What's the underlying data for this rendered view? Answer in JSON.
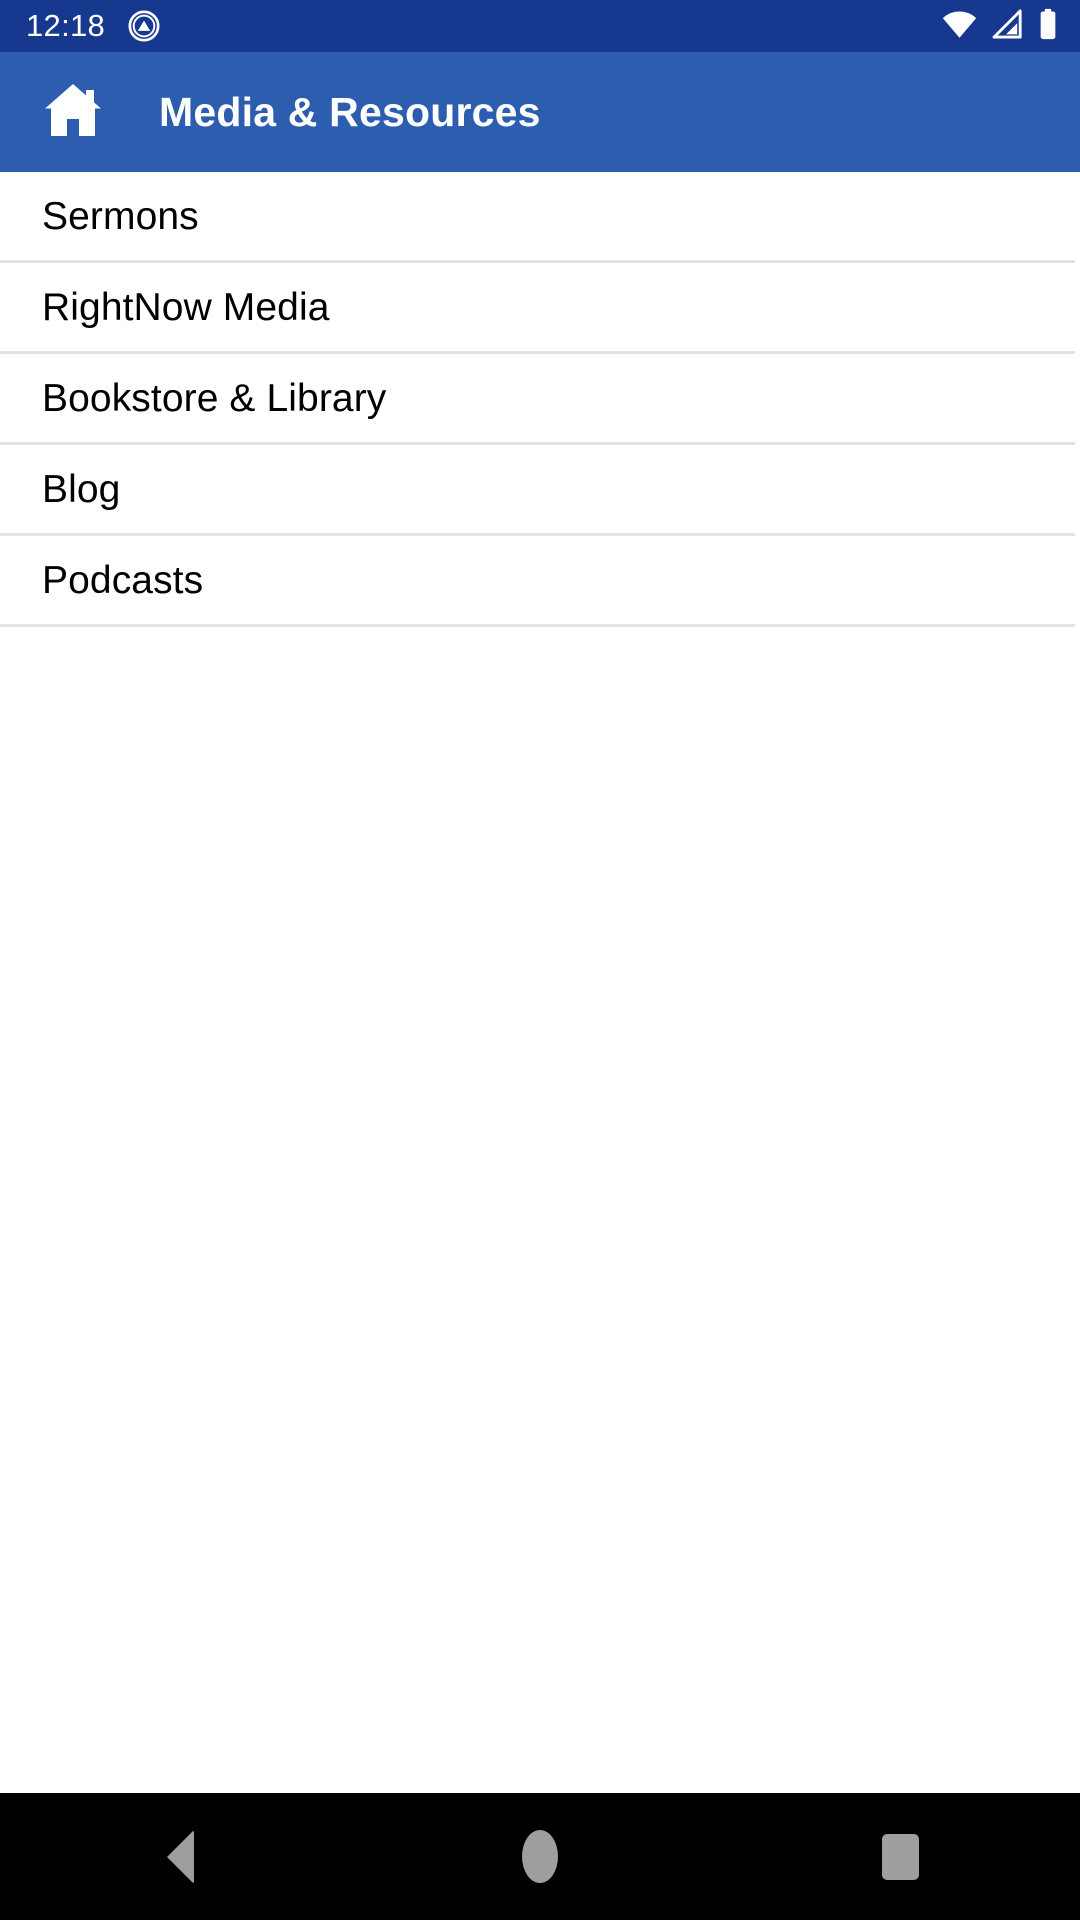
{
  "status_bar": {
    "time": "12:18",
    "background_color": "#16398f",
    "text_color": "#ffffff",
    "notification_icon": "app-notification-icon",
    "icons": [
      "wifi-icon",
      "cell-signal-icon",
      "battery-icon"
    ]
  },
  "app_bar": {
    "home_icon": "home-icon",
    "title": "Media & Resources",
    "background_color": "#2c5dae",
    "text_color": "#ffffff"
  },
  "list": {
    "background_color": "#ffffff",
    "divider_color": "#e2e2e2",
    "text_color": "#000000",
    "items": [
      {
        "label": "Sermons"
      },
      {
        "label": "RightNow Media"
      },
      {
        "label": "Bookstore & Library"
      },
      {
        "label": "Blog"
      },
      {
        "label": "Podcasts"
      }
    ]
  },
  "nav_bar": {
    "background_color": "#000000",
    "icon_color": "#9e9e9e",
    "buttons": [
      {
        "name": "back",
        "icon": "triangle-back-icon"
      },
      {
        "name": "home",
        "icon": "circle-home-icon"
      },
      {
        "name": "recents",
        "icon": "square-recents-icon"
      }
    ]
  }
}
